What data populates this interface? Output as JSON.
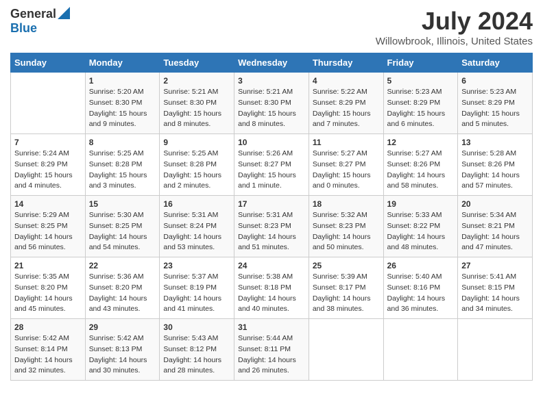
{
  "header": {
    "logo_general": "General",
    "logo_blue": "Blue",
    "title": "July 2024",
    "subtitle": "Willowbrook, Illinois, United States"
  },
  "days_of_week": [
    "Sunday",
    "Monday",
    "Tuesday",
    "Wednesday",
    "Thursday",
    "Friday",
    "Saturday"
  ],
  "weeks": [
    [
      {
        "day": "",
        "info": ""
      },
      {
        "day": "1",
        "info": "Sunrise: 5:20 AM\nSunset: 8:30 PM\nDaylight: 15 hours\nand 9 minutes."
      },
      {
        "day": "2",
        "info": "Sunrise: 5:21 AM\nSunset: 8:30 PM\nDaylight: 15 hours\nand 8 minutes."
      },
      {
        "day": "3",
        "info": "Sunrise: 5:21 AM\nSunset: 8:30 PM\nDaylight: 15 hours\nand 8 minutes."
      },
      {
        "day": "4",
        "info": "Sunrise: 5:22 AM\nSunset: 8:29 PM\nDaylight: 15 hours\nand 7 minutes."
      },
      {
        "day": "5",
        "info": "Sunrise: 5:23 AM\nSunset: 8:29 PM\nDaylight: 15 hours\nand 6 minutes."
      },
      {
        "day": "6",
        "info": "Sunrise: 5:23 AM\nSunset: 8:29 PM\nDaylight: 15 hours\nand 5 minutes."
      }
    ],
    [
      {
        "day": "7",
        "info": "Sunrise: 5:24 AM\nSunset: 8:29 PM\nDaylight: 15 hours\nand 4 minutes."
      },
      {
        "day": "8",
        "info": "Sunrise: 5:25 AM\nSunset: 8:28 PM\nDaylight: 15 hours\nand 3 minutes."
      },
      {
        "day": "9",
        "info": "Sunrise: 5:25 AM\nSunset: 8:28 PM\nDaylight: 15 hours\nand 2 minutes."
      },
      {
        "day": "10",
        "info": "Sunrise: 5:26 AM\nSunset: 8:27 PM\nDaylight: 15 hours\nand 1 minute."
      },
      {
        "day": "11",
        "info": "Sunrise: 5:27 AM\nSunset: 8:27 PM\nDaylight: 15 hours\nand 0 minutes."
      },
      {
        "day": "12",
        "info": "Sunrise: 5:27 AM\nSunset: 8:26 PM\nDaylight: 14 hours\nand 58 minutes."
      },
      {
        "day": "13",
        "info": "Sunrise: 5:28 AM\nSunset: 8:26 PM\nDaylight: 14 hours\nand 57 minutes."
      }
    ],
    [
      {
        "day": "14",
        "info": "Sunrise: 5:29 AM\nSunset: 8:25 PM\nDaylight: 14 hours\nand 56 minutes."
      },
      {
        "day": "15",
        "info": "Sunrise: 5:30 AM\nSunset: 8:25 PM\nDaylight: 14 hours\nand 54 minutes."
      },
      {
        "day": "16",
        "info": "Sunrise: 5:31 AM\nSunset: 8:24 PM\nDaylight: 14 hours\nand 53 minutes."
      },
      {
        "day": "17",
        "info": "Sunrise: 5:31 AM\nSunset: 8:23 PM\nDaylight: 14 hours\nand 51 minutes."
      },
      {
        "day": "18",
        "info": "Sunrise: 5:32 AM\nSunset: 8:23 PM\nDaylight: 14 hours\nand 50 minutes."
      },
      {
        "day": "19",
        "info": "Sunrise: 5:33 AM\nSunset: 8:22 PM\nDaylight: 14 hours\nand 48 minutes."
      },
      {
        "day": "20",
        "info": "Sunrise: 5:34 AM\nSunset: 8:21 PM\nDaylight: 14 hours\nand 47 minutes."
      }
    ],
    [
      {
        "day": "21",
        "info": "Sunrise: 5:35 AM\nSunset: 8:20 PM\nDaylight: 14 hours\nand 45 minutes."
      },
      {
        "day": "22",
        "info": "Sunrise: 5:36 AM\nSunset: 8:20 PM\nDaylight: 14 hours\nand 43 minutes."
      },
      {
        "day": "23",
        "info": "Sunrise: 5:37 AM\nSunset: 8:19 PM\nDaylight: 14 hours\nand 41 minutes."
      },
      {
        "day": "24",
        "info": "Sunrise: 5:38 AM\nSunset: 8:18 PM\nDaylight: 14 hours\nand 40 minutes."
      },
      {
        "day": "25",
        "info": "Sunrise: 5:39 AM\nSunset: 8:17 PM\nDaylight: 14 hours\nand 38 minutes."
      },
      {
        "day": "26",
        "info": "Sunrise: 5:40 AM\nSunset: 8:16 PM\nDaylight: 14 hours\nand 36 minutes."
      },
      {
        "day": "27",
        "info": "Sunrise: 5:41 AM\nSunset: 8:15 PM\nDaylight: 14 hours\nand 34 minutes."
      }
    ],
    [
      {
        "day": "28",
        "info": "Sunrise: 5:42 AM\nSunset: 8:14 PM\nDaylight: 14 hours\nand 32 minutes."
      },
      {
        "day": "29",
        "info": "Sunrise: 5:42 AM\nSunset: 8:13 PM\nDaylight: 14 hours\nand 30 minutes."
      },
      {
        "day": "30",
        "info": "Sunrise: 5:43 AM\nSunset: 8:12 PM\nDaylight: 14 hours\nand 28 minutes."
      },
      {
        "day": "31",
        "info": "Sunrise: 5:44 AM\nSunset: 8:11 PM\nDaylight: 14 hours\nand 26 minutes."
      },
      {
        "day": "",
        "info": ""
      },
      {
        "day": "",
        "info": ""
      },
      {
        "day": "",
        "info": ""
      }
    ]
  ]
}
